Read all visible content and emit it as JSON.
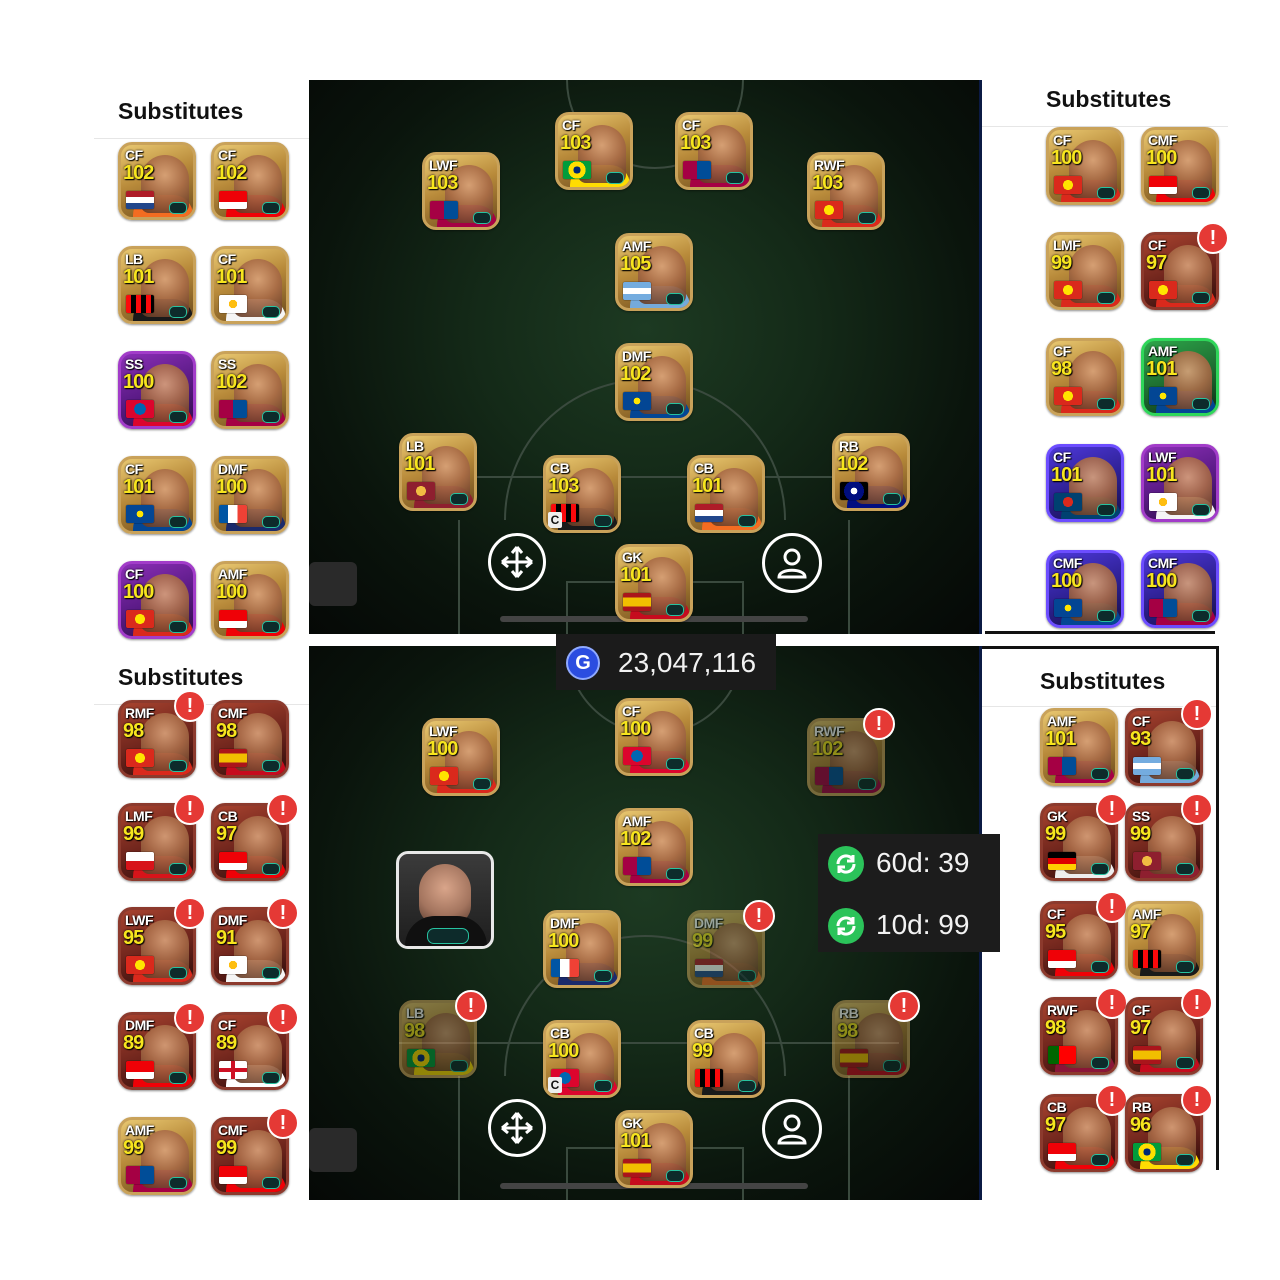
{
  "colors": {
    "pitch_dark": "#0a140c",
    "rating_yellow": "#f7e51e",
    "alert_red": "#e53935",
    "gp_blue": "#2b4de0",
    "timer_green": "#2bc35a"
  },
  "top_left_subs": {
    "title": "Substitutes",
    "cards": [
      {
        "pos": "CF",
        "rating": "102",
        "style": "gold",
        "flag": "netherlands"
      },
      {
        "pos": "CF",
        "rating": "102",
        "style": "gold",
        "flag": "arsenal"
      },
      {
        "pos": "LB",
        "rating": "101",
        "style": "gold",
        "flag": "milan"
      },
      {
        "pos": "CF",
        "rating": "101",
        "style": "gold",
        "flag": "madrid"
      },
      {
        "pos": "SS",
        "rating": "100",
        "style": "purple",
        "flag": "bayern"
      },
      {
        "pos": "SS",
        "rating": "102",
        "style": "gold",
        "flag": "barcelona"
      },
      {
        "pos": "CF",
        "rating": "101",
        "style": "gold",
        "flag": "chelsea"
      },
      {
        "pos": "DMF",
        "rating": "100",
        "style": "gold",
        "flag": "france"
      },
      {
        "pos": "CF",
        "rating": "100",
        "style": "purple",
        "flag": "manutd"
      },
      {
        "pos": "AMF",
        "rating": "100",
        "style": "gold",
        "flag": "arsenal"
      }
    ]
  },
  "top_right_subs": {
    "title": "Substitutes",
    "cards": [
      {
        "pos": "CF",
        "rating": "100",
        "style": "gold",
        "flag": "manutd"
      },
      {
        "pos": "CMF",
        "rating": "100",
        "style": "gold",
        "flag": "arsenal"
      },
      {
        "pos": "LMF",
        "rating": "99",
        "style": "gold",
        "flag": "manutd"
      },
      {
        "pos": "CF",
        "rating": "97",
        "style": "maroon",
        "flag": "manutd",
        "alert": "!"
      },
      {
        "pos": "CF",
        "rating": "98",
        "style": "gold",
        "flag": "manutd"
      },
      {
        "pos": "AMF",
        "rating": "101",
        "style": "green",
        "flag": "chelsea"
      },
      {
        "pos": "CF",
        "rating": "101",
        "style": "blue",
        "flag": "psg"
      },
      {
        "pos": "LWF",
        "rating": "101",
        "style": "purple",
        "flag": "madrid"
      },
      {
        "pos": "CMF",
        "rating": "100",
        "style": "blue",
        "flag": "chelsea"
      },
      {
        "pos": "CMF",
        "rating": "100",
        "style": "blue",
        "flag": "barcelona"
      }
    ]
  },
  "top_pitch": {
    "players": [
      {
        "pos": "LWF",
        "rating": "103",
        "flag": "barcelona"
      },
      {
        "pos": "CF",
        "rating": "103",
        "flag": "brazil"
      },
      {
        "pos": "CF",
        "rating": "103",
        "flag": "barcelona"
      },
      {
        "pos": "RWF",
        "rating": "103",
        "flag": "manutd"
      },
      {
        "pos": "AMF",
        "rating": "105",
        "flag": "argentina"
      },
      {
        "pos": "DMF",
        "rating": "102",
        "flag": "chelsea"
      },
      {
        "pos": "LB",
        "rating": "101",
        "flag": "roma"
      },
      {
        "pos": "CB",
        "rating": "103",
        "flag": "milan",
        "captain": "C"
      },
      {
        "pos": "CB",
        "rating": "101",
        "flag": "netherlands"
      },
      {
        "pos": "RB",
        "rating": "102",
        "flag": "inter"
      },
      {
        "pos": "GK",
        "rating": "101",
        "flag": "spain"
      }
    ]
  },
  "gp": {
    "icon": "G",
    "value": "23,047,116"
  },
  "bottom_left_subs": {
    "title": "Substitutes",
    "cards": [
      {
        "pos": "RMF",
        "rating": "98",
        "style": "maroon",
        "flag": "manutd",
        "alert": "!"
      },
      {
        "pos": "CMF",
        "rating": "98",
        "style": "maroon",
        "flag": "spain"
      },
      {
        "pos": "LMF",
        "rating": "99",
        "style": "maroon",
        "flag": "czech",
        "alert": "!"
      },
      {
        "pos": "CB",
        "rating": "97",
        "style": "maroon",
        "flag": "arsenal",
        "alert": "!"
      },
      {
        "pos": "LWF",
        "rating": "95",
        "style": "maroon",
        "flag": "manutd",
        "alert": "!"
      },
      {
        "pos": "DMF",
        "rating": "91",
        "style": "maroon",
        "flag": "madrid",
        "alert": "!"
      },
      {
        "pos": "DMF",
        "rating": "89",
        "style": "maroon",
        "flag": "arsenal",
        "alert": "!"
      },
      {
        "pos": "CF",
        "rating": "89",
        "style": "maroon",
        "flag": "england",
        "alert": "!"
      },
      {
        "pos": "AMF",
        "rating": "99",
        "style": "gold",
        "flag": "barcelona"
      },
      {
        "pos": "CMF",
        "rating": "99",
        "style": "maroon",
        "flag": "arsenal",
        "alert": "!"
      }
    ]
  },
  "bottom_right_subs": {
    "title": "Substitutes",
    "cards": [
      {
        "pos": "AMF",
        "rating": "101",
        "style": "gold",
        "flag": "barcelona"
      },
      {
        "pos": "CF",
        "rating": "93",
        "style": "maroon",
        "flag": "argentina",
        "alert": "!"
      },
      {
        "pos": "GK",
        "rating": "99",
        "style": "maroon",
        "flag": "germany",
        "alert": "!"
      },
      {
        "pos": "SS",
        "rating": "99",
        "style": "maroon",
        "flag": "roma",
        "alert": "!"
      },
      {
        "pos": "CF",
        "rating": "95",
        "style": "maroon",
        "flag": "arsenal",
        "alert": "!"
      },
      {
        "pos": "AMF",
        "rating": "97",
        "style": "gold",
        "flag": "milan"
      },
      {
        "pos": "RWF",
        "rating": "98",
        "style": "maroon",
        "flag": "portugal",
        "alert": "!"
      },
      {
        "pos": "CF",
        "rating": "97",
        "style": "maroon",
        "flag": "spain",
        "alert": "!"
      },
      {
        "pos": "CB",
        "rating": "97",
        "style": "maroon",
        "flag": "arsenal",
        "alert": "!"
      },
      {
        "pos": "RB",
        "rating": "96",
        "style": "maroon",
        "flag": "brazil",
        "alert": "!"
      }
    ]
  },
  "bottom_pitch": {
    "players": [
      {
        "pos": "LWF",
        "rating": "100",
        "flag": "manutd"
      },
      {
        "pos": "CF",
        "rating": "100",
        "flag": "bayern"
      },
      {
        "pos": "RWF",
        "rating": "102",
        "flag": "barcelona",
        "faded": true,
        "alert": "!"
      },
      {
        "pos": "AMF",
        "rating": "102",
        "flag": "barcelona"
      },
      {
        "pos": "DMF",
        "rating": "100",
        "flag": "france"
      },
      {
        "pos": "DMF",
        "rating": "99",
        "flag": "netherlands",
        "faded": true,
        "alert": "!"
      },
      {
        "pos": "LB",
        "rating": "98",
        "flag": "brazil",
        "faded": true,
        "alert": "!"
      },
      {
        "pos": "CB",
        "rating": "100",
        "flag": "bayern",
        "captain": "C"
      },
      {
        "pos": "CB",
        "rating": "99",
        "flag": "milan"
      },
      {
        "pos": "RB",
        "rating": "98",
        "flag": "spain",
        "faded": true,
        "alert": "!"
      },
      {
        "pos": "GK",
        "rating": "101",
        "flag": "spain"
      }
    ]
  },
  "timers": [
    {
      "icon": "refresh-icon",
      "text": "60d: 39"
    },
    {
      "icon": "refresh-icon",
      "text": "10d: 99"
    }
  ],
  "icons": {
    "move": "move-arrows-icon",
    "player": "person-icon",
    "alert": "exclamation-icon"
  }
}
